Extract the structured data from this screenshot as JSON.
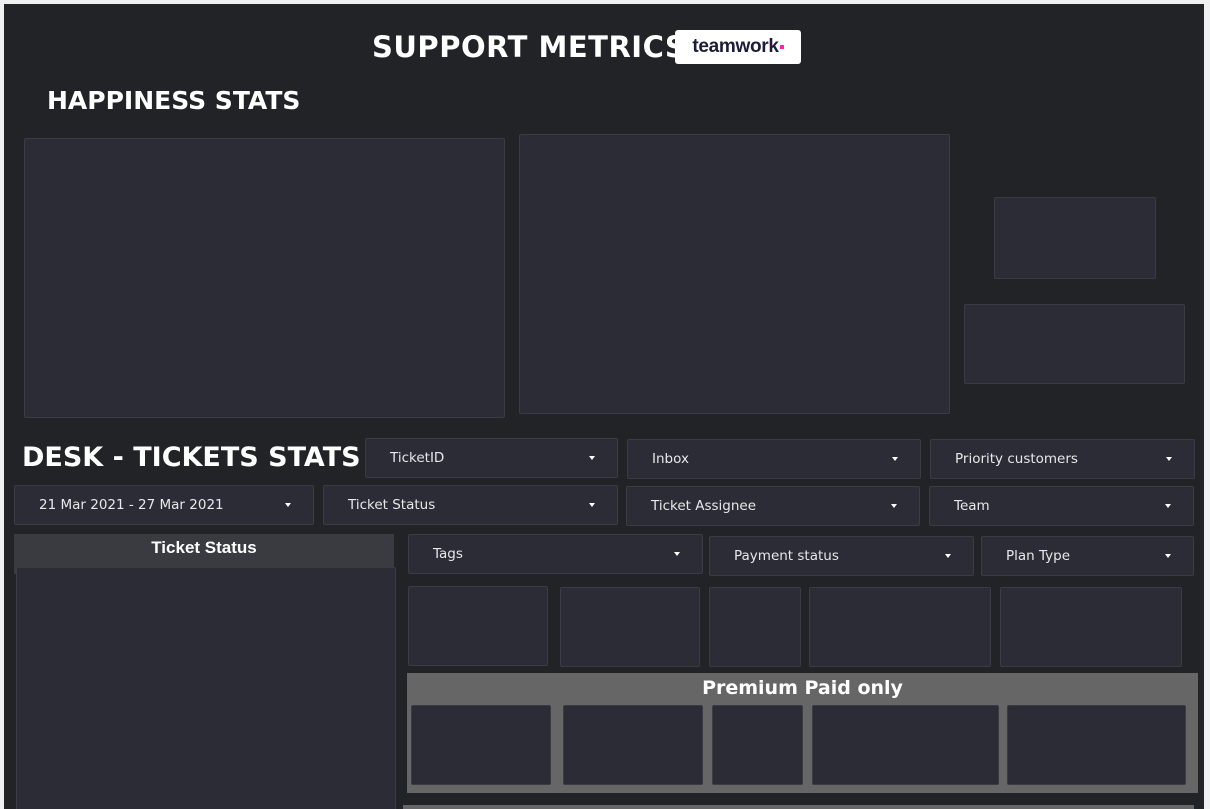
{
  "header": {
    "title": "SUPPORT METRICS",
    "logo_text": "teamwork"
  },
  "sections": {
    "happiness": "HAPPINESS STATS",
    "desk": "DESK - TICKETS STATS"
  },
  "filters": {
    "ticket_id": "TicketID",
    "inbox": "Inbox",
    "priority_customers": "Priority customers",
    "date_range": "21 Mar 2021 - 27 Mar 2021",
    "ticket_status": "Ticket Status",
    "ticket_assignee": "Ticket Assignee",
    "team": "Team",
    "tags": "Tags",
    "payment_status": "Payment status",
    "plan_type": "Plan Type"
  },
  "ticket_status_panel": {
    "title": "Ticket Status"
  },
  "premium": {
    "title": "Premium Paid only"
  },
  "colors": {
    "background": "#222327",
    "panel": "#2b2c35",
    "premium_bar": "#666666",
    "logo_accent": "#ff22b1"
  }
}
